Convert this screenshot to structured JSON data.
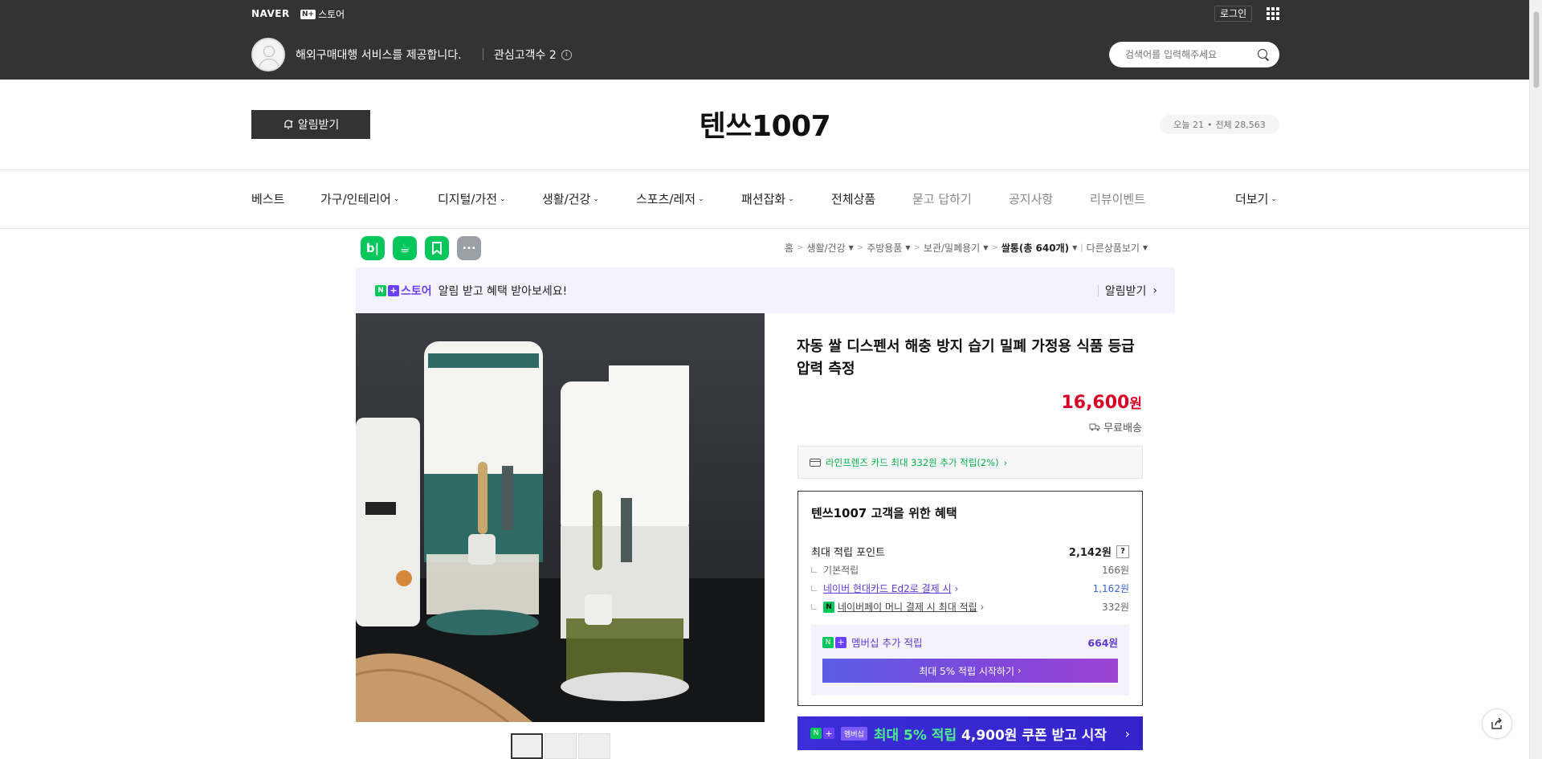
{
  "topbar": {
    "naver": "NAVER",
    "nplus": "N+",
    "store": "스토어",
    "login": "로그인",
    "service": "해외구매대행 서비스를 제공합니다.",
    "interest": "관심고객수 2",
    "search_placeholder": "검색어를 입력해주세요"
  },
  "header": {
    "alarm": "알림받기",
    "store_name": "텐쓰1007",
    "today": "오늘 21",
    "total": "전체 28,563"
  },
  "nav": {
    "items": [
      {
        "label": "베스트"
      },
      {
        "label": "가구/인테리어"
      },
      {
        "label": "디지털/가전"
      },
      {
        "label": "생활/건강"
      },
      {
        "label": "스포츠/레저"
      },
      {
        "label": "패션잡화"
      },
      {
        "label": "전체상품"
      },
      {
        "label": "묻고 답하기"
      },
      {
        "label": "공지사항"
      },
      {
        "label": "리뷰이벤트"
      }
    ],
    "more": "더보기"
  },
  "icons": [
    "blog-icon",
    "cafe-icon",
    "bookmark-icon",
    "more-icon"
  ],
  "breadcrumb": {
    "home": "홈",
    "c1": "생활/건강",
    "c2": "주방용품",
    "c3": "보관/밀폐용기",
    "c4": "쌀통(총 640개)",
    "other": "다른상품보기"
  },
  "notice": {
    "store": "스토어",
    "text": "알림 받고 혜택 받아보세요!",
    "button": "알림받기"
  },
  "product": {
    "title": "자동 쌀 디스펜서 해충 방지 습기 밀폐 가정용 식품 등급 압력 측정",
    "price": "16,600",
    "won": "원",
    "shipping": "무료배송",
    "card_benefit": "라인프렌즈 카드 최대 332원 추가 적립(2%)"
  },
  "benefit": {
    "title": "텐쓰1007 고객을 위한 혜택",
    "max_label": "최대 적립 포인트",
    "max_value": "2,142원",
    "basic_label": "기본적립",
    "basic_value": "166원",
    "hyundai_label": "네이버 현대카드 Ed2로 결제 시",
    "hyundai_value": "1,162원",
    "npay_label": "네이버페이 머니 결제 시 최대 적립",
    "npay_value": "332원",
    "member_label": "멤버십 추가 적립",
    "member_value": "664원",
    "member_btn": "최대 5% 적립 시작하기"
  },
  "coupon": {
    "tag": "멤버십",
    "text_a": "최대 5% 적립",
    "text_b": "4,900원 쿠폰 받고 시작"
  },
  "colors": {
    "price": "#d70025",
    "naver_green": "#03c75a",
    "nplus_purple": "#6b41ff",
    "topbar": "#333333"
  }
}
